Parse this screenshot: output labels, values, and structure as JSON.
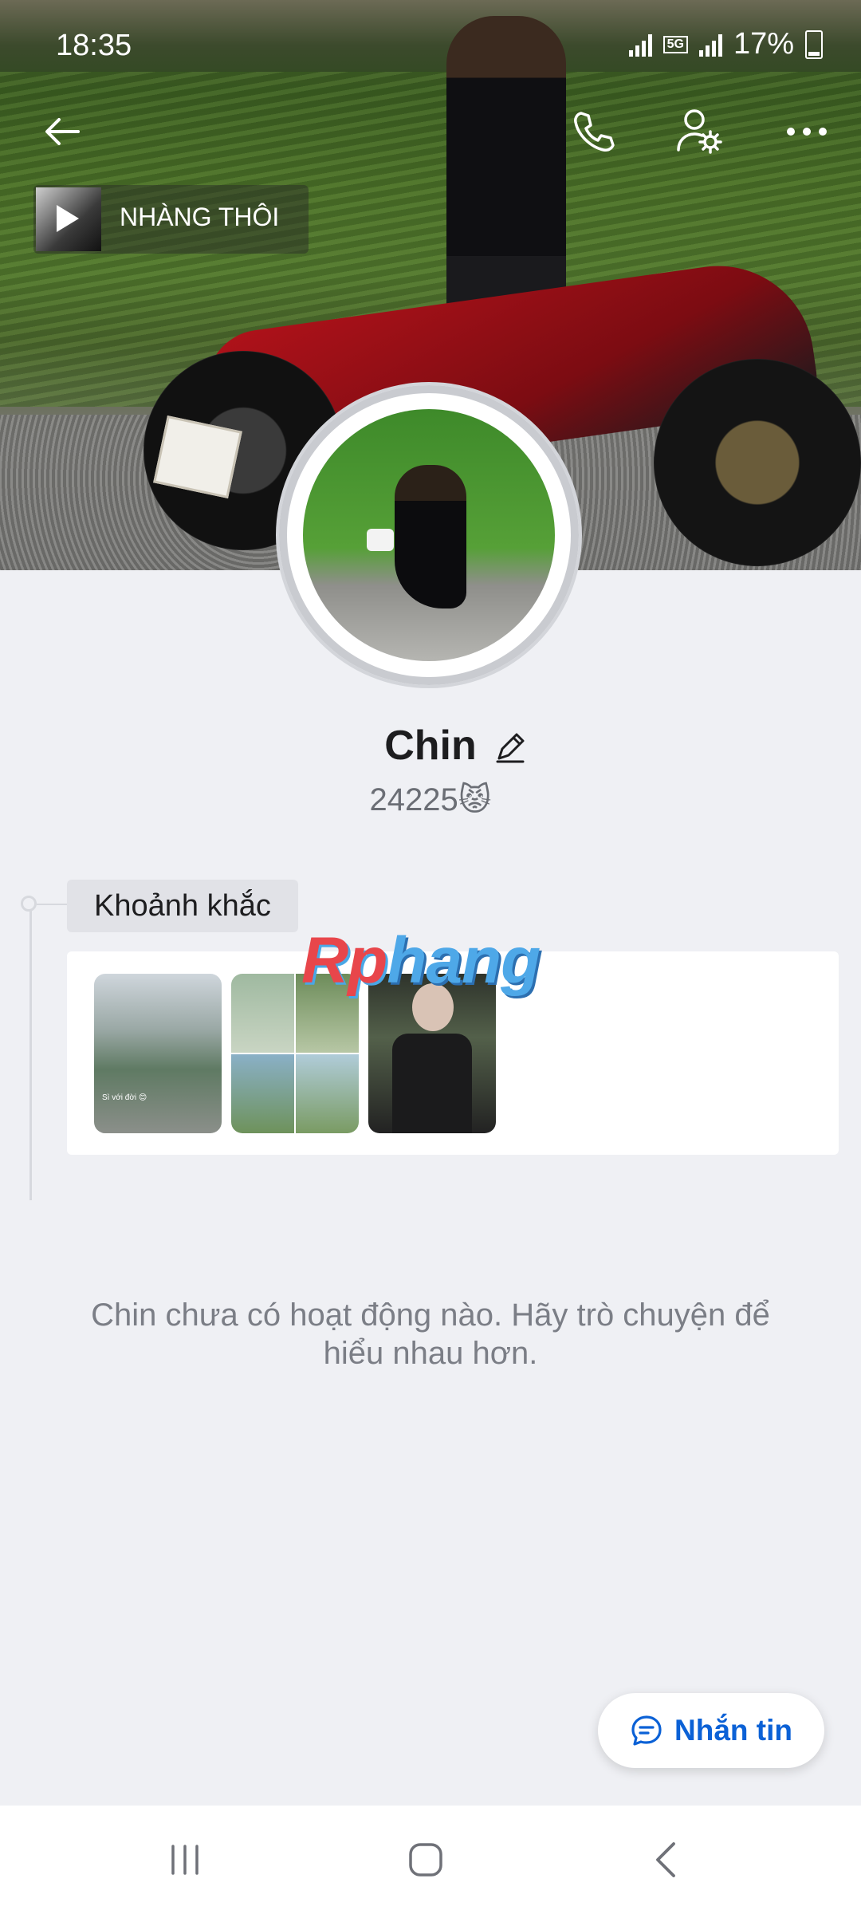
{
  "status_bar": {
    "time": "18:35",
    "network": "5G",
    "battery": "17%"
  },
  "music": {
    "title": "NHÀNG THÔI"
  },
  "profile": {
    "name": "Chin",
    "bio": "24225😾"
  },
  "moments": {
    "label": "Khoảnh khắc",
    "thumb1_caption": "Sì với đời 😊"
  },
  "watermark": {
    "part1": "Rp",
    "part2": "hang"
  },
  "empty_state": "Chin chưa có hoạt động nào. Hãy trò chuyện để hiểu nhau hơn.",
  "actions": {
    "message_label": "Nhắn tin"
  },
  "colors": {
    "accent": "#0b61d6",
    "background": "#eff0f4"
  },
  "icons": [
    "back-arrow-icon",
    "phone-icon",
    "user-settings-icon",
    "more-icon",
    "play-icon",
    "pencil-icon",
    "chat-bubble-icon",
    "recent-apps-icon",
    "home-icon",
    "nav-back-icon"
  ]
}
